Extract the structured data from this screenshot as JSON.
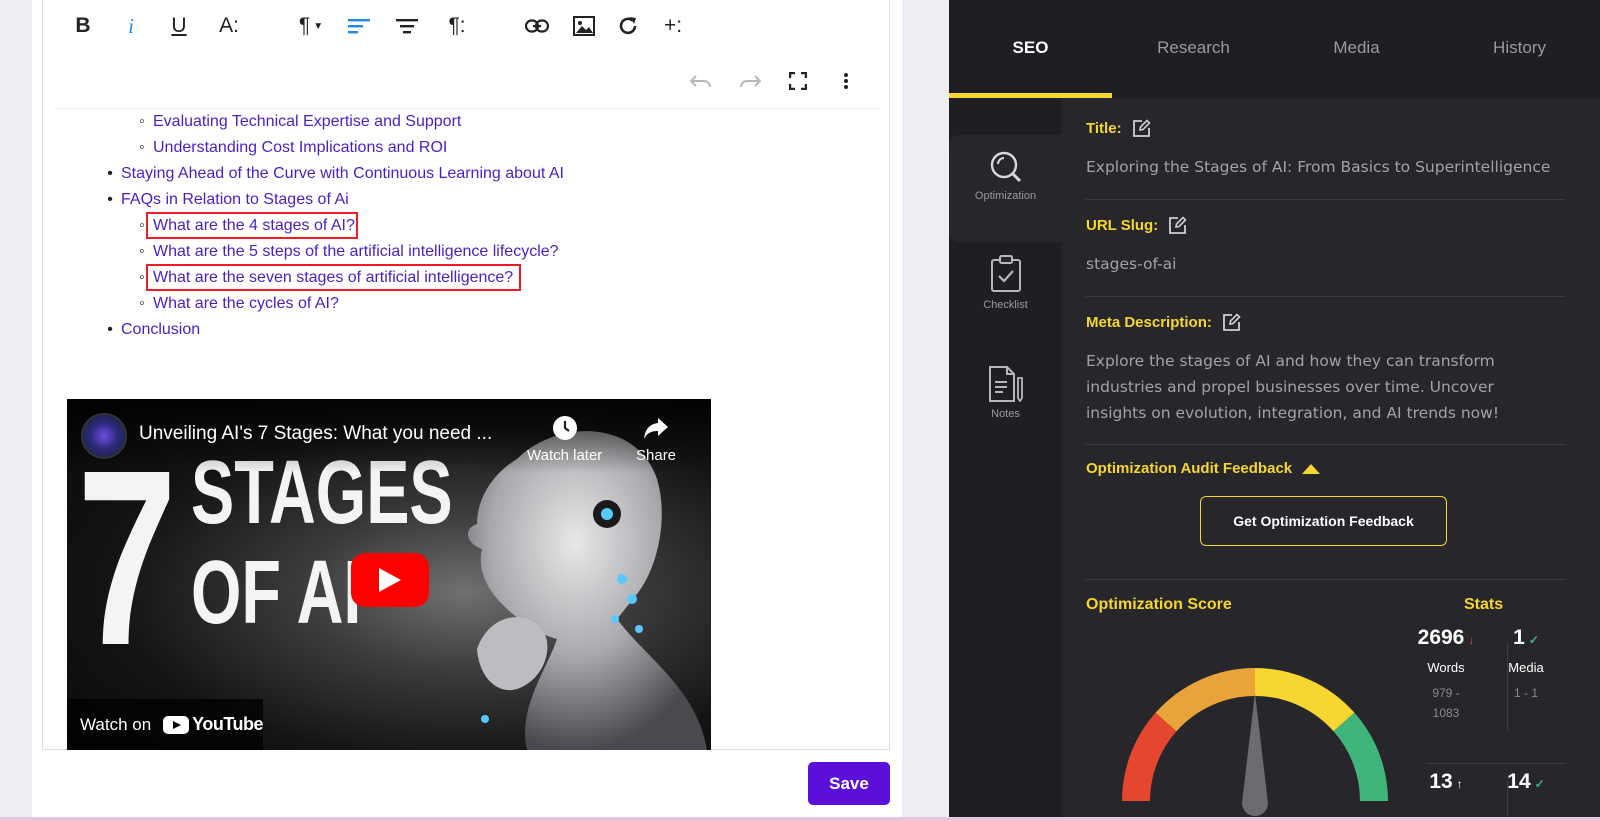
{
  "toolbar": {
    "bold_label": "B",
    "italic_label": "i",
    "underline_label": "U",
    "font_size_label": "A:",
    "paragraph_label": "¶",
    "para_options_label": "¶:",
    "add_block_label": "+:"
  },
  "outline": {
    "items": [
      {
        "level": 2,
        "text": "Evaluating Technical Expertise and Support"
      },
      {
        "level": 2,
        "text": "Understanding Cost Implications and ROI"
      },
      {
        "level": 1,
        "text": "Staying Ahead of the Curve with Continuous Learning about AI"
      },
      {
        "level": 1,
        "text": "FAQs in Relation to Stages of Ai"
      },
      {
        "level": 2,
        "text": "What are the 4 stages of AI?",
        "highlighted": true
      },
      {
        "level": 2,
        "text": "What are the 5 steps of the artificial intelligence lifecycle?"
      },
      {
        "level": 2,
        "text": "What are the seven stages of artificial intelligence?",
        "highlighted": true
      },
      {
        "level": 2,
        "text": "What are the cycles of AI?"
      },
      {
        "level": 1,
        "text": "Conclusion"
      }
    ]
  },
  "video": {
    "title": "Unveiling AI's 7 Stages: What you need ...",
    "watch_later": "Watch later",
    "share": "Share",
    "watch_on": "Watch on",
    "youtube": "YouTube",
    "thumb_number": "7",
    "thumb_line1": "STAGES",
    "thumb_line2": "OF AI"
  },
  "save_label": "Save",
  "tabs": [
    {
      "label": "SEO",
      "active": true
    },
    {
      "label": "Research",
      "active": false
    },
    {
      "label": "Media",
      "active": false
    },
    {
      "label": "History",
      "active": false
    }
  ],
  "side_nav": [
    {
      "label": "Optimization",
      "icon": "magnifier-icon",
      "active": true
    },
    {
      "label": "Checklist",
      "icon": "clipboard-check-icon",
      "active": false
    },
    {
      "label": "Notes",
      "icon": "notes-icon",
      "active": false
    }
  ],
  "seo": {
    "title_label": "Title:",
    "title_value": "Exploring the Stages of AI: From Basics to Superintelligence",
    "slug_label": "URL Slug:",
    "slug_value": "stages-of-ai",
    "meta_label": "Meta Description:",
    "meta_lines": [
      "Explore the stages of AI and how they can transform",
      "industries and propel businesses over time. Uncover",
      "insights on evolution, integration, and AI trends now!"
    ],
    "audit_label": "Optimization Audit Feedback",
    "feedback_button": "Get Optimization Feedback",
    "score_label": "Optimization Score",
    "stats_label": "Stats"
  },
  "stats": {
    "words": {
      "value": "2696",
      "label": "Words",
      "range_line1": "979 -",
      "range_line2": "1083",
      "trend": "down"
    },
    "media": {
      "value": "1",
      "label": "Media",
      "range": "1 - 1",
      "status": "ok"
    },
    "third": {
      "value": "13",
      "trend": "up"
    },
    "fourth": {
      "value": "14",
      "status": "ok"
    }
  },
  "colors": {
    "accent_yellow": "#f6d630",
    "save_purple": "#5b0fd8",
    "link_purple": "#4b1fc4",
    "highlight_red": "#ee1c25",
    "gauge_red": "#e4462e",
    "gauge_orange": "#e8a33a",
    "gauge_yellow": "#f6d630",
    "gauge_green": "#3fb57a"
  }
}
